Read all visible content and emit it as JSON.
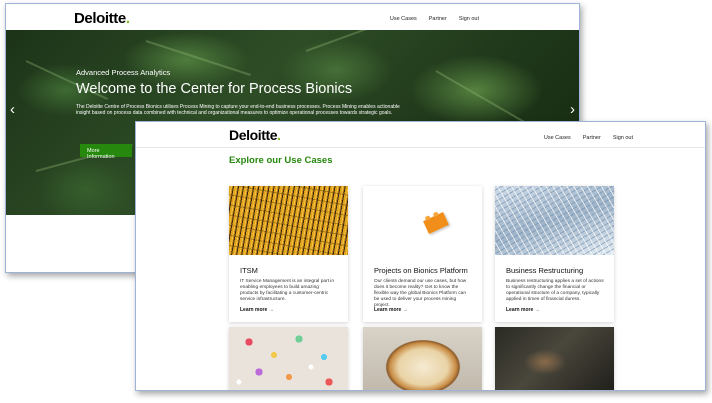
{
  "back_window": {
    "logo_text": "Deloitte",
    "logo_dot": ".",
    "nav": [
      "Use Cases",
      "Partner",
      "Sign out"
    ],
    "hero": {
      "kicker": "Advanced Process Analytics",
      "title": "Welcome to the Center for Process Bionics",
      "description": "The Deloitte Centre of Process Bionics utilises Process Mining to capture your end-to-end business processes. Process Mining enables actionable insight based on process data combined with technical and organizational measures to optimize operational processes towards strategic goals.",
      "button_label": "More Information",
      "prev_arrow": "‹",
      "next_arrow": "›"
    }
  },
  "front_window": {
    "logo_text": "Deloitte",
    "logo_dot": ".",
    "nav": [
      "Use Cases",
      "Partner",
      "Sign out"
    ],
    "section_title": "Explore our Use Cases",
    "cards": [
      {
        "title": "ITSM",
        "description": "IT Service Management is an integral part in enabling employees to build amazing products by facilitating a customer-centric service infrastructure.",
        "link": "Learn more →",
        "image": "yellow-cables-image"
      },
      {
        "title": "Projects on Bionics Platform",
        "description": "Our clients demand our use cases, but how does it become reality? Get to know the flexible way the global Bionics Platform can be used to deliver your process mining project.",
        "link": "Learn more →",
        "image": "orange-lego-brick-image"
      },
      {
        "title": "Business Restructuring",
        "description": "Business restructuring applies a set of actions to significantly change the financial or operational structure of a company, typically applied in times of financial duress.",
        "link": "Learn more →",
        "image": "glass-building-image"
      }
    ],
    "row2_images": [
      "colorful-pills-image",
      "meringue-pie-image",
      "dark-coffee-image"
    ]
  },
  "colors": {
    "brand_green": "#86bc25",
    "accent_green": "#26890d",
    "window_border": "#9fb3d6"
  }
}
